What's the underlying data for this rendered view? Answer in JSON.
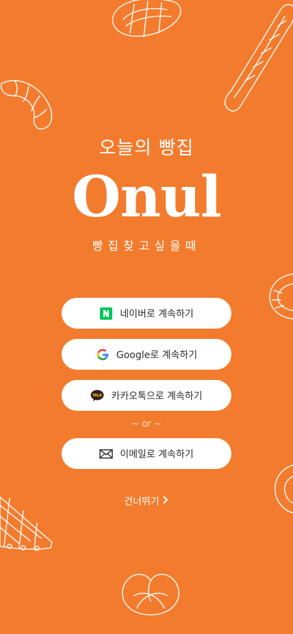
{
  "brand": {
    "subtitle": "오늘의 빵집",
    "logo": "Onul",
    "tagline": "빵집찾고싶을때"
  },
  "login": {
    "naver": {
      "label": "네이버로 계속하기",
      "icon": "naver-icon",
      "color": "#03C75A"
    },
    "google": {
      "label": "Google로 계속하기",
      "icon": "google-icon"
    },
    "kakao": {
      "label": "카카오톡으로 계속하기",
      "icon": "kakao-talk-icon",
      "icon_text": "TALK"
    },
    "divider": "~ or ~",
    "email": {
      "label": "이메일로 계속하기",
      "icon": "mail-icon"
    }
  },
  "skip": {
    "label": "건너뛰기",
    "icon": "chevron-right-icon"
  },
  "colors": {
    "background": "#F37B2D",
    "button": "#FFFFFF",
    "text": "#FFFFFF"
  }
}
